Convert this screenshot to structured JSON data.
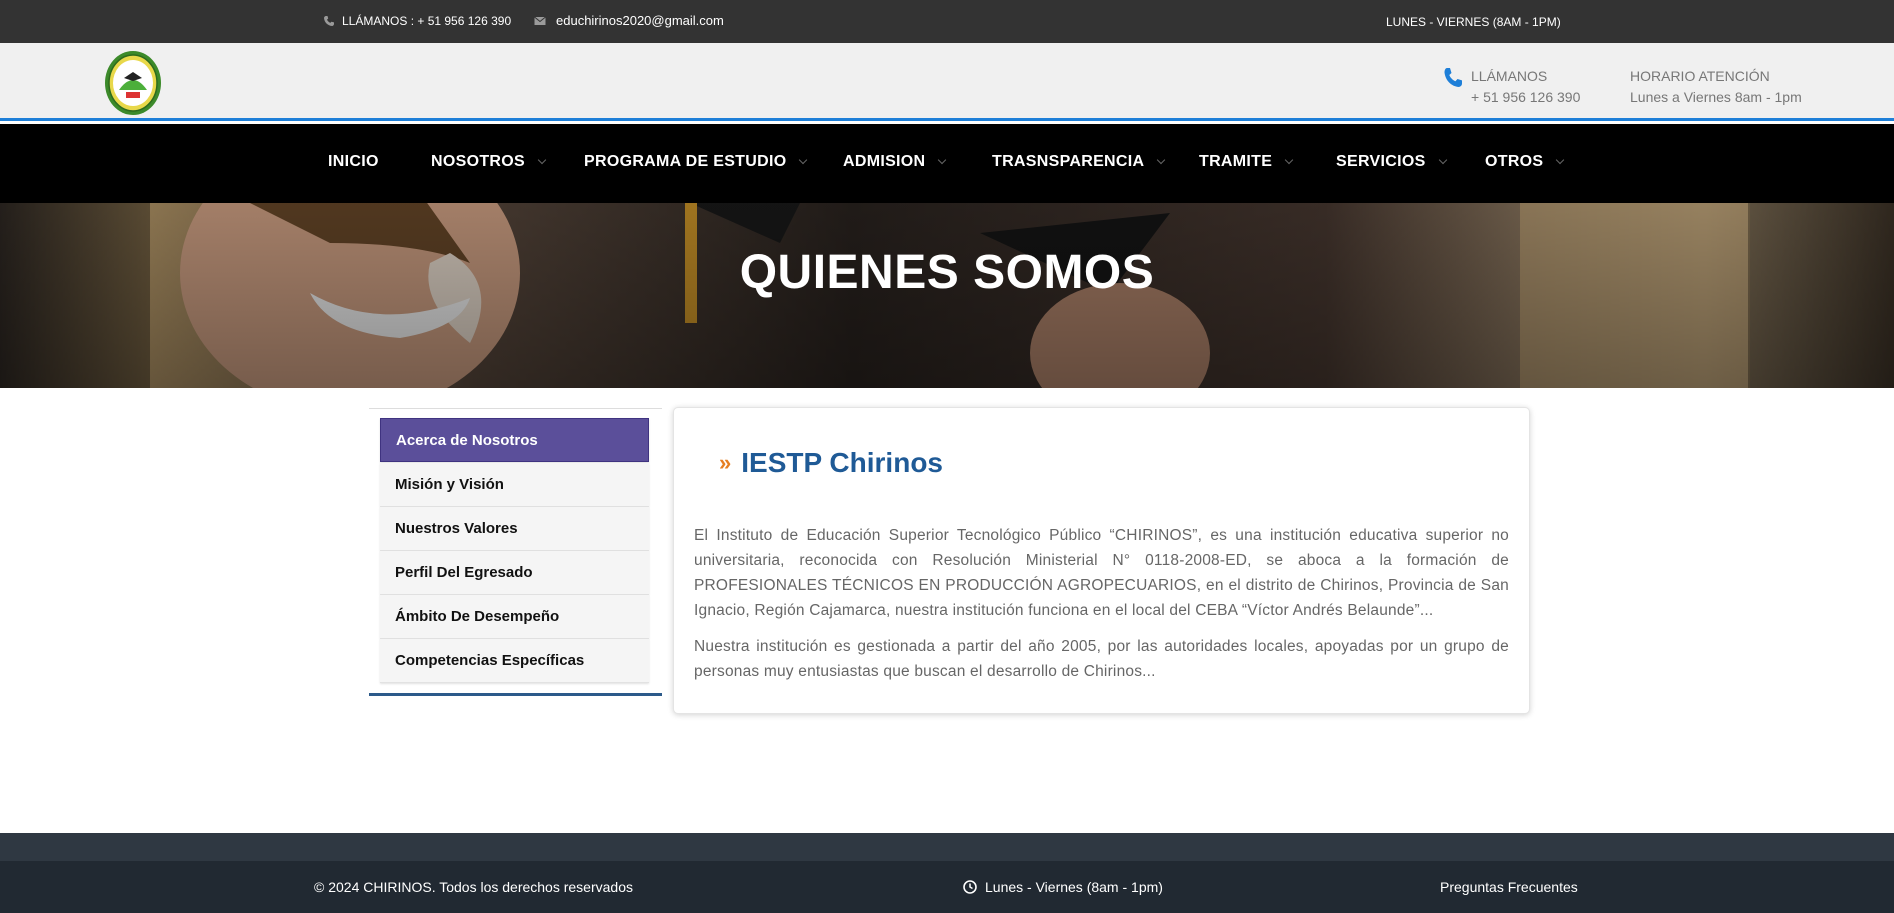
{
  "topbar": {
    "phone_text": "LLÁMANOS : + 51 956 126 390",
    "email": "educhirinos2020@gmail.com",
    "hours": "LUNES - VIERNES   (8AM - 1PM)",
    "phone_icon": "phone-icon",
    "email_icon": "envelope-icon"
  },
  "header": {
    "logo_icon": "institution-seal-logo",
    "call_label": "LLÁMANOS",
    "call_number": "+ 51 956 126 390",
    "hours_label": "HORARIO ATENCIÓN",
    "hours_value": "Lunes a Viernes 8am - 1pm",
    "phone_icon": "phone-icon",
    "accent_color": "#1e7fd8"
  },
  "nav": {
    "items": [
      {
        "label": "INICIO"
      },
      {
        "label": "NOSOTROS"
      },
      {
        "label": "PROGRAMA DE ESTUDIO"
      },
      {
        "label": "ADMISION"
      },
      {
        "label": "TRASNSPARENCIA"
      },
      {
        "label": "TRAMITE"
      },
      {
        "label": "SERVICIOS"
      },
      {
        "label": "OTROS"
      }
    ]
  },
  "hero": {
    "title": "QUIENES SOMOS"
  },
  "sidebar": {
    "items": [
      {
        "label": "Acerca de Nosotros"
      },
      {
        "label": "Misión y Visión"
      },
      {
        "label": "Nuestros Valores"
      },
      {
        "label": "Perfil Del Egresado"
      },
      {
        "label": "Ámbito De Desempeño"
      },
      {
        "label": "Competencias Específicas"
      }
    ],
    "active_color": "#5b4f9a"
  },
  "content": {
    "heading_marker": "»",
    "heading": "IESTP Chirinos",
    "paragraphs": [
      "El Instituto de Educación Superior Tecnológico Público “CHIRINOS”, es una institución educativa superior no universitaria, reconocida con Resolución Ministerial N° 0118-2008-ED, se aboca a la formación de PROFESIONALES TÉCNICOS EN PRODUCCIÓN AGROPECUARIOS, en el distrito de Chirinos, Provincia de San Ignacio, Región Cajamarca, nuestra institución funciona en el local del CEBA “Víctor Andrés Belaunde”...",
      "Nuestra institución es gestionada a partir del año 2005, por las autoridades locales, apoyadas por un grupo de personas muy entusiastas que buscan el desarrollo de Chirinos..."
    ]
  },
  "footer": {
    "copyright": "© 2024 CHIRINOS. Todos los derechos reservados",
    "hours": "Lunes - Viernes   (8am - 1pm)",
    "faq": "Preguntas Frecuentes",
    "clock_icon": "clock-icon"
  }
}
